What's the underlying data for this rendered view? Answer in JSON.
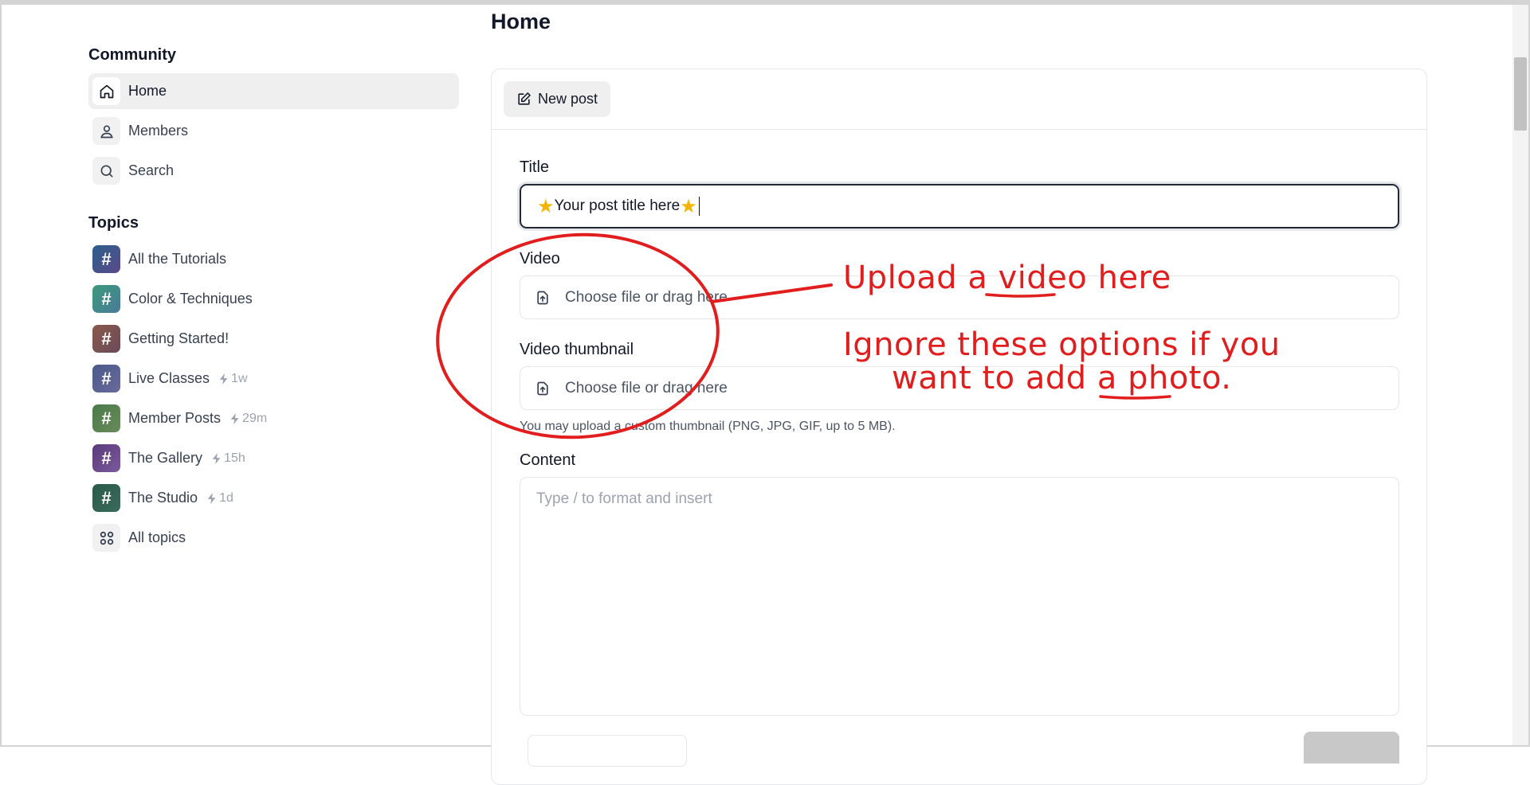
{
  "page": {
    "title": "Home"
  },
  "sidebar": {
    "community_title": "Community",
    "nav": [
      {
        "label": "Home",
        "icon": "home-icon",
        "active": true
      },
      {
        "label": "Members",
        "icon": "user-icon",
        "active": false
      },
      {
        "label": "Search",
        "icon": "search-icon",
        "active": false
      }
    ],
    "topics_title": "Topics",
    "topics": [
      {
        "label": "All the Tutorials",
        "activity": "",
        "color_from": "#2d5f8a",
        "color_to": "#5a4a8a"
      },
      {
        "label": "Color & Techniques",
        "activity": "",
        "color_from": "#3a9a7a",
        "color_to": "#4a7a9a"
      },
      {
        "label": "Getting Started!",
        "activity": "",
        "color_from": "#8a5a4a",
        "color_to": "#6a4a5a"
      },
      {
        "label": "Live Classes",
        "activity": "1w",
        "color_from": "#4a5a8a",
        "color_to": "#6a6a9a"
      },
      {
        "label": "Member Posts",
        "activity": "29m",
        "color_from": "#4a7a4a",
        "color_to": "#6a8a5a"
      },
      {
        "label": "The Gallery",
        "activity": "15h",
        "color_from": "#5a3a7a",
        "color_to": "#7a5a9a"
      },
      {
        "label": "The Studio",
        "activity": "1d",
        "color_from": "#2a5a4a",
        "color_to": "#3a6a5a"
      }
    ],
    "all_topics_label": "All topics"
  },
  "composer": {
    "new_post_label": "New post",
    "title_label": "Title",
    "title_value": "Your post title here",
    "video_label": "Video",
    "video_placeholder": "Choose file or drag here",
    "thumbnail_label": "Video thumbnail",
    "thumbnail_placeholder": "Choose file or drag here",
    "thumbnail_hint": "You may upload a custom thumbnail (PNG, JPG, GIF, up to 5 MB).",
    "content_label": "Content",
    "content_placeholder": "Type / to format and insert"
  },
  "annotations": {
    "color": "#e11d1d",
    "upload_note_prefix": "Upload a ",
    "upload_note_word": "video",
    "upload_note_suffix": " here",
    "ignore_line1": "Ignore these options if you",
    "ignore_line2_prefix": "want to add a ",
    "ignore_line2_word": "photo",
    "ignore_line2_suffix": "."
  }
}
